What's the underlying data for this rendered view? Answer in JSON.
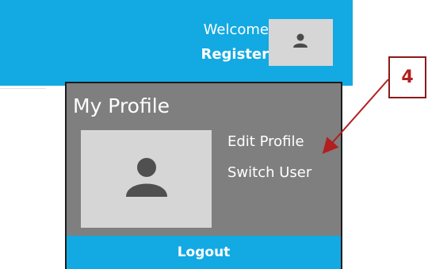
{
  "header": {
    "welcome_text": "Welcome",
    "register_label": "Register",
    "avatar_icon": "user-icon",
    "background_color": "#13a9e3"
  },
  "profile_menu": {
    "title": "My Profile",
    "avatar_icon": "user-icon",
    "items": [
      {
        "label": "Edit Profile"
      },
      {
        "label": "Switch User"
      }
    ],
    "logout_label": "Logout",
    "background_color": "#7f7f7f",
    "logout_color": "#13a9e3"
  },
  "annotation": {
    "number": "4",
    "color": "#b21f1f"
  }
}
